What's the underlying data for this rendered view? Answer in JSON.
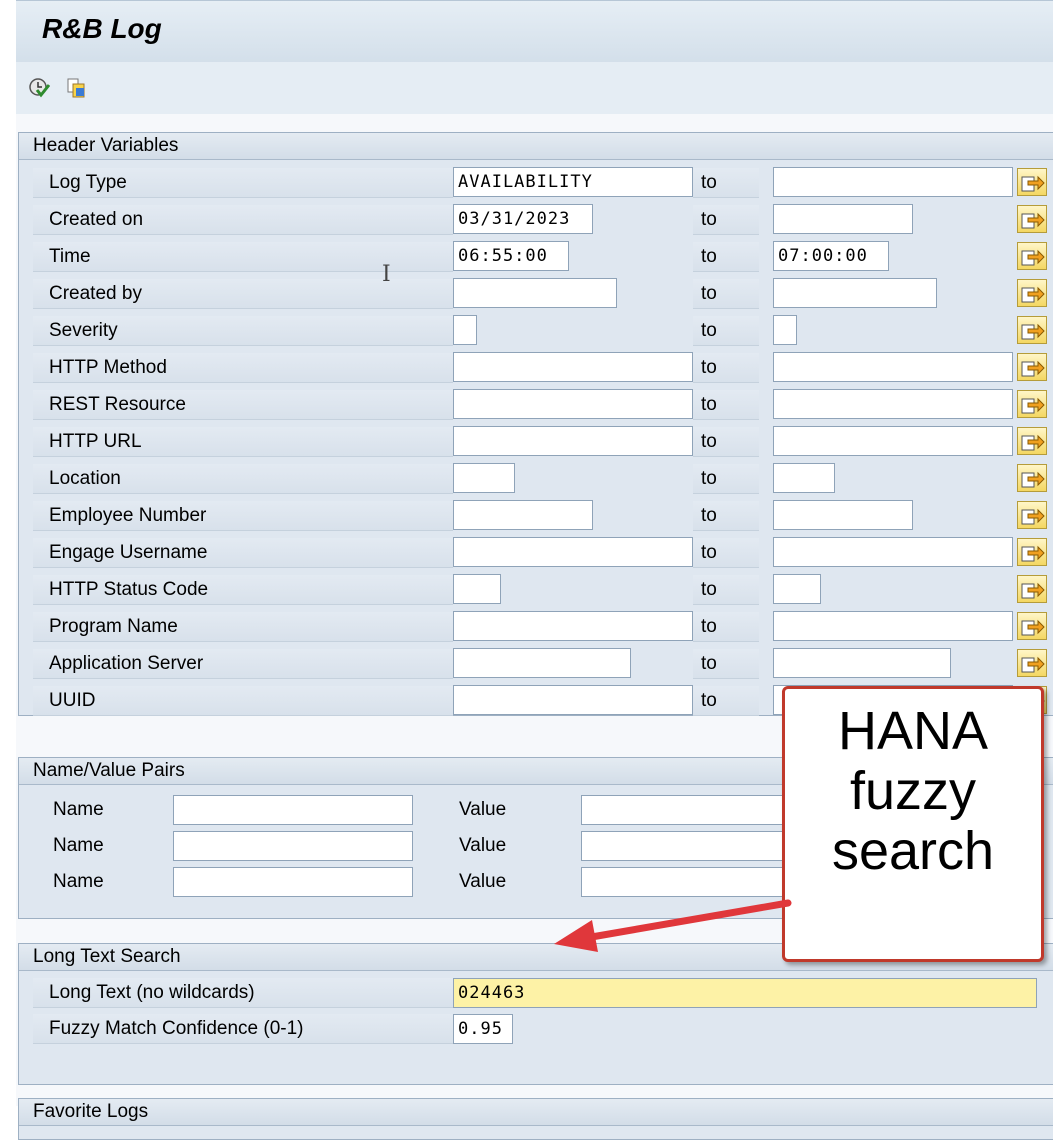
{
  "app": {
    "title": "R&B Log"
  },
  "toolbar": {
    "execute_icon": "execute-clock-icon",
    "variant_icon": "get-variant-icon"
  },
  "header_variables": {
    "title": "Header Variables",
    "to_label": "to",
    "rows": [
      {
        "label": "Log Type",
        "from": "AVAILABILITY",
        "to": ""
      },
      {
        "label": "Created on",
        "from": "03/31/2023",
        "to": ""
      },
      {
        "label": "Time",
        "from": "06:55:00",
        "to": "07:00:00"
      },
      {
        "label": "Created by",
        "from": "",
        "to": ""
      },
      {
        "label": "Severity",
        "from": "",
        "to": ""
      },
      {
        "label": "HTTP Method",
        "from": "",
        "to": ""
      },
      {
        "label": "REST Resource",
        "from": "",
        "to": ""
      },
      {
        "label": "HTTP URL",
        "from": "",
        "to": ""
      },
      {
        "label": "Location",
        "from": "",
        "to": ""
      },
      {
        "label": "Employee Number",
        "from": "",
        "to": ""
      },
      {
        "label": "Engage Username",
        "from": "",
        "to": ""
      },
      {
        "label": "HTTP Status Code",
        "from": "",
        "to": ""
      },
      {
        "label": "Program Name",
        "from": "",
        "to": ""
      },
      {
        "label": "Application Server",
        "from": "",
        "to": ""
      },
      {
        "label": "UUID",
        "from": "",
        "to": ""
      }
    ]
  },
  "name_value_pairs": {
    "title": "Name/Value Pairs",
    "name_label": "Name",
    "value_label": "Value",
    "rows": [
      {
        "name": "",
        "value": ""
      },
      {
        "name": "",
        "value": ""
      },
      {
        "name": "",
        "value": ""
      }
    ]
  },
  "long_text_search": {
    "title": "Long Text Search",
    "long_text_label": "Long Text (no wildcards)",
    "long_text_value": "024463",
    "fuzzy_label": "Fuzzy Match Confidence (0-1)",
    "fuzzy_value": "0.95"
  },
  "favorite_logs": {
    "title": "Favorite Logs"
  },
  "callout": {
    "line1": "HANA",
    "line2": "fuzzy",
    "line3": "search",
    "border_color": "#c0392b"
  },
  "colors": {
    "highlight_field": "#fdf2a6",
    "multi_button": "#f4d762",
    "panel": "#dfe7f0"
  }
}
